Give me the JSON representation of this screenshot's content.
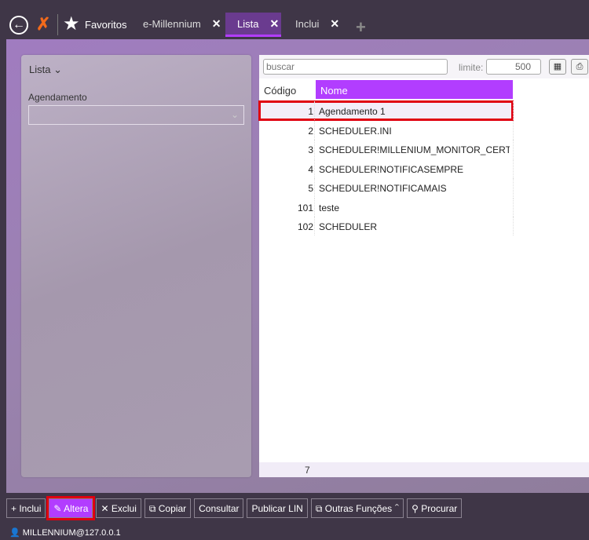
{
  "topbar": {
    "favorites": "Favoritos",
    "tabs": [
      {
        "label": "e-Millennium"
      },
      {
        "label": "Lista"
      },
      {
        "label": "Inclui"
      }
    ]
  },
  "left": {
    "section": "Lista",
    "field_label": "Agendamento",
    "field_value": ""
  },
  "right": {
    "search_placeholder": "buscar",
    "limit_label": "limite:",
    "limit_value": "500",
    "columns": [
      "Código",
      "Nome"
    ],
    "rows": [
      {
        "code": "1",
        "name": "Agendamento 1"
      },
      {
        "code": "2",
        "name": "SCHEDULER.INI"
      },
      {
        "code": "3",
        "name": "SCHEDULER!MILLENIUM_MONITOR_CERTIFI..."
      },
      {
        "code": "4",
        "name": "SCHEDULER!NOTIFICASEMPRE"
      },
      {
        "code": "5",
        "name": "SCHEDULER!NOTIFICAMAIS"
      },
      {
        "code": "101",
        "name": "teste"
      },
      {
        "code": "102",
        "name": "SCHEDULER"
      }
    ],
    "count": "7"
  },
  "buttons": {
    "inclui": "Inclui",
    "altera": "Altera",
    "exclui": "Exclui",
    "copiar": "Copiar",
    "consultar": "Consultar",
    "publicar": "Publicar LIN",
    "outras": "Outras Funções",
    "procurar": "Procurar"
  },
  "status": "MILLENNIUM@127.0.0.1"
}
